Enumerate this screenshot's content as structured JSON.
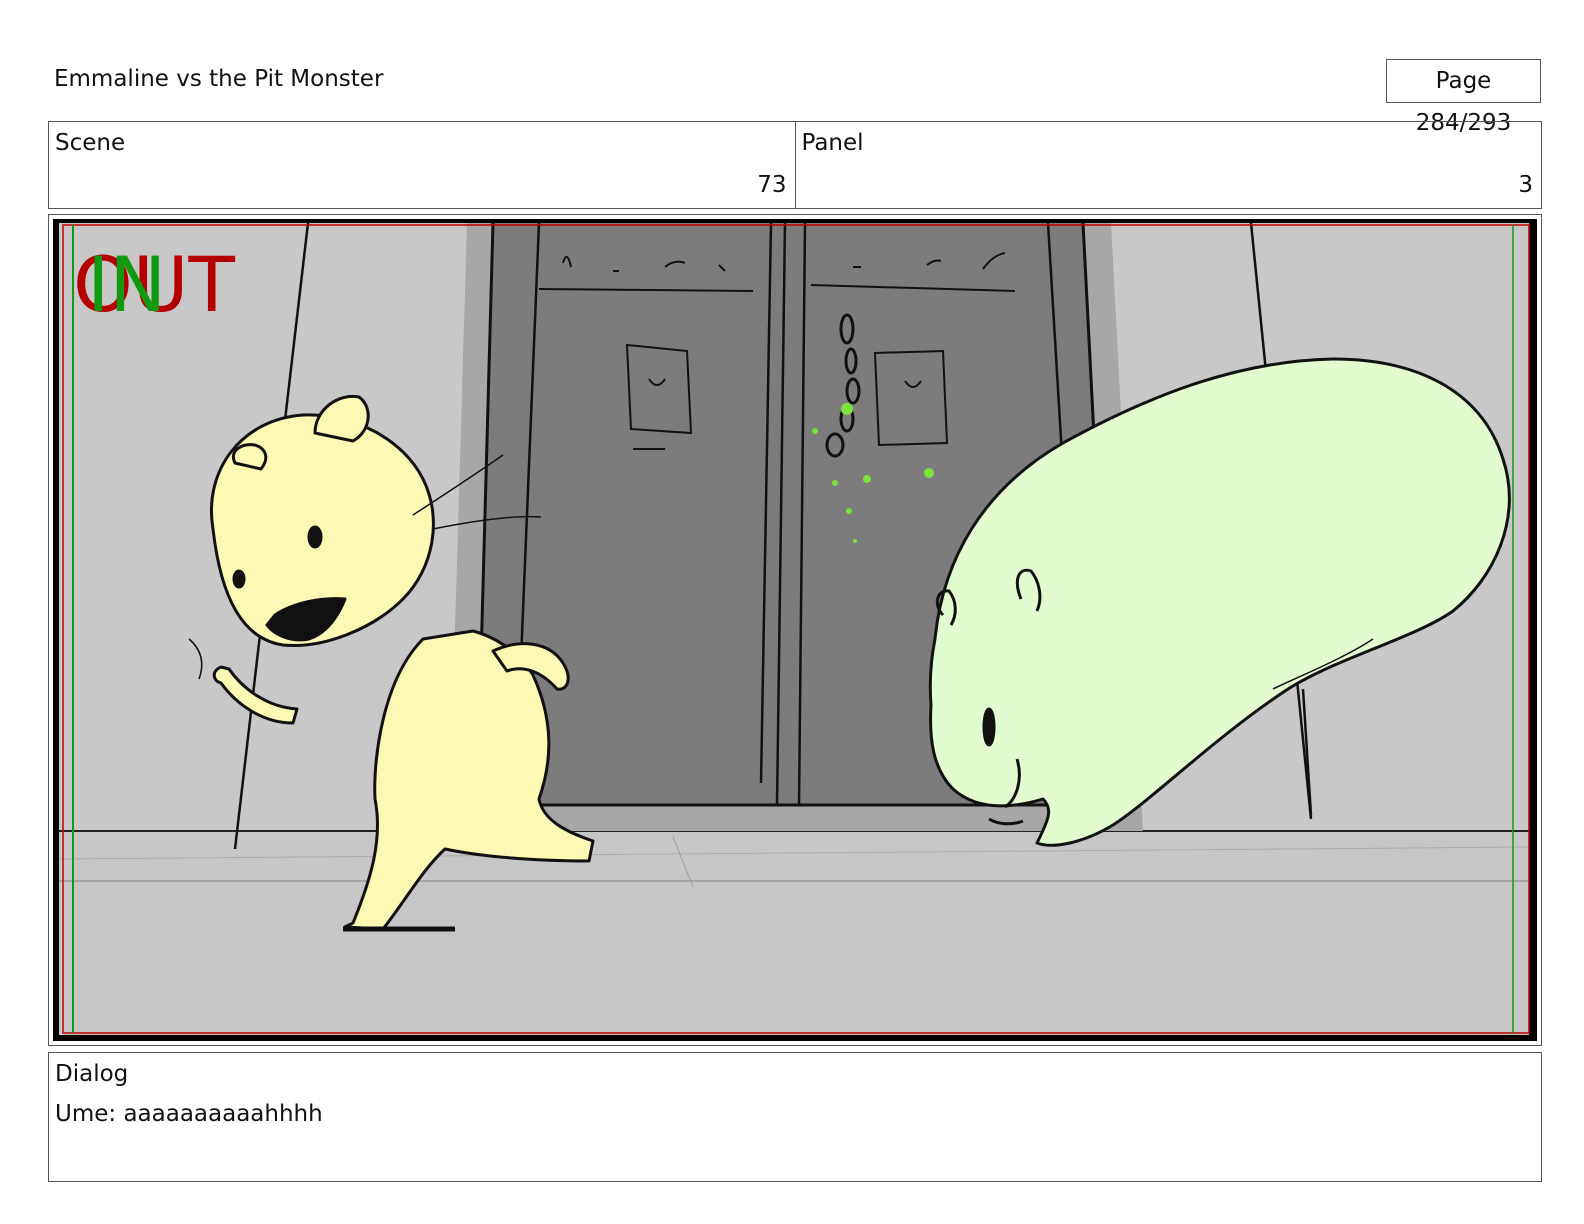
{
  "header": {
    "project_title": "Emmaline vs the Pit Monster",
    "page_label": "Page 284/293"
  },
  "scene": {
    "label": "Scene",
    "value": "73"
  },
  "panel": {
    "label": "Panel",
    "value": "3"
  },
  "frame_markers": {
    "out_label": "OUT",
    "in_label": "IN"
  },
  "dialog": {
    "label": "Dialog",
    "text": "Ume: aaaaaaaaaahhhh"
  },
  "colors": {
    "wall": "#c8c8c8",
    "door": "#7c7c7c",
    "ume_fill": "#fdf8b4",
    "monster_fill": "#e3fccf",
    "slime": "#7be33c",
    "out_marker": "#b40000",
    "in_marker": "#119911"
  }
}
